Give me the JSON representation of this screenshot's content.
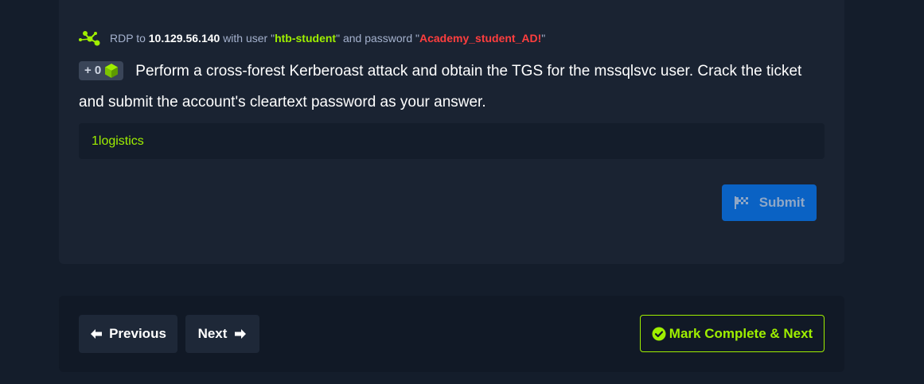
{
  "connection": {
    "prefix": "RDP to",
    "ip": "10.129.56.140",
    "with_user": "with user",
    "quote_open": "\"",
    "quote_close": "\"",
    "username": "htb-student",
    "and_password": "and password",
    "password": "Academy_student_AD!"
  },
  "question": {
    "badge_text": "+ 0",
    "badge_icon": "cube-icon",
    "text": "Perform a cross-forest Kerberoast attack and obtain the TGS for the mssqlsvc user. Crack the ticket and submit the account's cleartext password as your answer."
  },
  "answer": {
    "value": "1logistics"
  },
  "submit": {
    "label": "Submit",
    "icon": "flag-icon"
  },
  "navigation": {
    "previous_label": "Previous",
    "next_label": "Next",
    "complete_label": "Mark Complete & Next"
  },
  "colors": {
    "accent_green": "#9fef00",
    "password_red": "#ff3e3e",
    "submit_blue": "#0a62c4",
    "page_bg": "#141d2b",
    "card_bg": "#1a2332"
  }
}
